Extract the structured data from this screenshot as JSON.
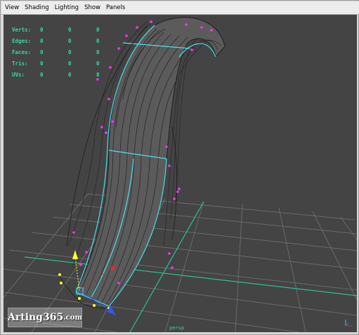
{
  "menu": [
    "View",
    "Shading",
    "Lighting",
    "Show",
    "Panels"
  ],
  "hud": [
    {
      "label": "Verts:",
      "values": [
        "0",
        "0",
        "0"
      ]
    },
    {
      "label": "Edges:",
      "values": [
        "0",
        "0",
        "0"
      ]
    },
    {
      "label": "Faces:",
      "values": [
        "0",
        "0",
        "0"
      ]
    },
    {
      "label": "Tris:",
      "values": [
        "0",
        "0",
        "0"
      ]
    },
    {
      "label": "UVs:",
      "values": [
        "0",
        "0",
        "0"
      ]
    }
  ],
  "watermark": {
    "name": "Arting365",
    "tld": ".com"
  },
  "camera": "persp",
  "colors": {
    "viewport_bg": "#444444",
    "grid": "#6a6a6a",
    "grid_axis": "#2bbf9a",
    "hud_text": "#38d6a8",
    "vertex": "#ff33ff",
    "edge_selected": "#49e0f0",
    "mesh_fill": "#5a5a5a",
    "mesh_lines": "#222222"
  }
}
